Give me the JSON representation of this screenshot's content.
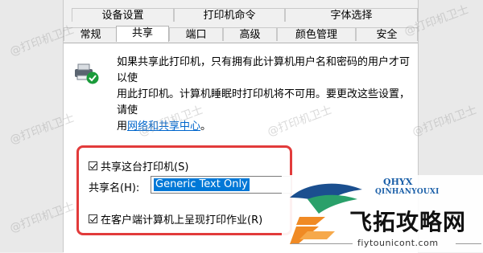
{
  "tabs_row1": [
    {
      "label": "设备设置"
    },
    {
      "label": "打印机命令"
    },
    {
      "label": "字体选择"
    }
  ],
  "tabs_row2": [
    {
      "label": "常规"
    },
    {
      "label": "共享",
      "active": true
    },
    {
      "label": "端口"
    },
    {
      "label": "高级"
    },
    {
      "label": "颜色管理"
    },
    {
      "label": "安全"
    }
  ],
  "description": {
    "line1": "如果共享此打印机，只有拥有此计算机用户名和密码的用户才可以使",
    "line2": "用此打印机。计算机睡眠时打印机将不可用。要更改这些设置，请使",
    "line3_prefix": "用",
    "link": "网络和共享中心",
    "line3_suffix": "。"
  },
  "share_checkbox": {
    "label": "共享这台打印机(S)",
    "checked": true
  },
  "share_name": {
    "label": "共享名(H):",
    "value": "Generic  Text Only"
  },
  "render_checkbox": {
    "label": "在客户端计算机上呈现打印作业(R)",
    "checked": true
  },
  "watermark": "@打印机卫士",
  "logo": {
    "brand": "QHYX",
    "brand_sub": "QINHANYOUXI",
    "title": "飞拓攻略网",
    "url": "fiytounicont.com"
  },
  "colors": {
    "highlight_box": "#e23b3b",
    "selection": "#0078d7",
    "link": "#0066cc"
  }
}
